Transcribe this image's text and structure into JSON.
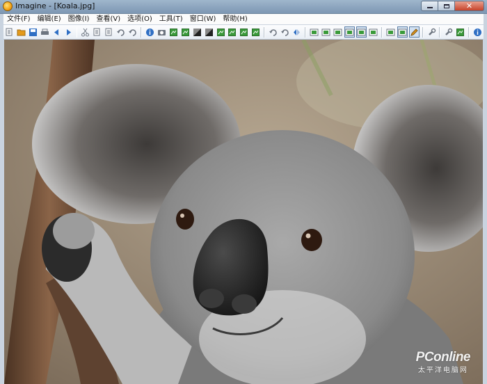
{
  "window": {
    "title": "Imagine - [Koala.jpg]",
    "controls": {
      "minimize": "minimize",
      "maximize": "maximize",
      "close": "close"
    }
  },
  "menu": {
    "items": [
      "文件(F)",
      "编辑(E)",
      "图像(I)",
      "查看(V)",
      "选项(O)",
      "工具(T)",
      "窗口(W)",
      "帮助(H)"
    ]
  },
  "toolbar": {
    "groups": [
      [
        "new-icon",
        "open-icon",
        "save-icon",
        "print-icon",
        "prev-icon",
        "next-icon"
      ],
      [
        "cut-icon",
        "copy-icon",
        "paste-icon",
        "undo-icon",
        "redo-icon"
      ],
      [
        "info-icon",
        "capture-icon",
        "export-icon",
        "import-icon",
        "grayscale-icon",
        "invert-icon",
        "palette-icon",
        "effect-icon",
        "filter-icon",
        "sharpen-icon"
      ],
      [
        "rotate-left-icon",
        "rotate-right-icon",
        "flip-icon"
      ],
      [
        "zoom-in-icon",
        "zoom-out-icon",
        "zoom-fit-icon",
        "actual-size-icon",
        "view-mode-icon",
        "fullscreen-icon"
      ],
      [
        "monitor-icon",
        "thumbnail-icon",
        "edit-icon"
      ],
      [
        "settings-icon"
      ],
      [
        "plugin-icon",
        "batch-icon"
      ],
      [
        "help-icon"
      ]
    ],
    "active": [
      "actual-size-icon",
      "view-mode-icon",
      "thumbnail-icon",
      "edit-icon"
    ],
    "colors": {
      "blue": "#2f6fc4",
      "green": "#3a9a3a",
      "red": "#c8402a",
      "orange": "#e49a1c",
      "gray": "#6d7580"
    }
  },
  "image": {
    "file": "Koala.jpg",
    "subject": "koala",
    "colors": {
      "fur": "#8f8f8f",
      "fur_light": "#cfcfcf",
      "nose": "#2a2a2a",
      "eye": "#3b2415",
      "branch": "#6b4a34",
      "background": "#9a8b78"
    }
  },
  "watermark": {
    "logo": "PConline",
    "sub": "太平洋电脑网"
  }
}
